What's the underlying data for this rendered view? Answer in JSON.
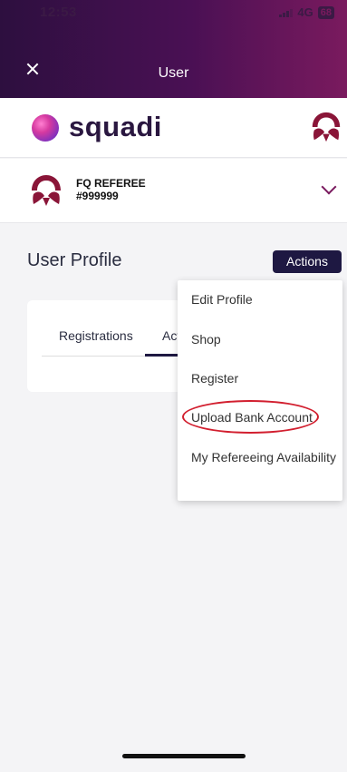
{
  "status_bar": {
    "time": "12:53",
    "network": "4G",
    "battery": "68"
  },
  "header": {
    "title": "User"
  },
  "brand": {
    "name": "squadi"
  },
  "user": {
    "name": "FQ REFEREE",
    "id": "#999999"
  },
  "profile": {
    "title": "User Profile",
    "actions_label": "Actions"
  },
  "tabs": [
    {
      "label": "Registrations"
    },
    {
      "label": "Activity"
    }
  ],
  "menu": {
    "items": [
      {
        "label": "Edit Profile"
      },
      {
        "label": "Shop"
      },
      {
        "label": "Register"
      },
      {
        "label": "Upload Bank Account",
        "highlighted": true
      },
      {
        "label": "My Refereeing Availability"
      }
    ]
  },
  "colors": {
    "accent": "#7a1a5e",
    "button": "#1e1842",
    "highlight": "#d21f2f"
  }
}
